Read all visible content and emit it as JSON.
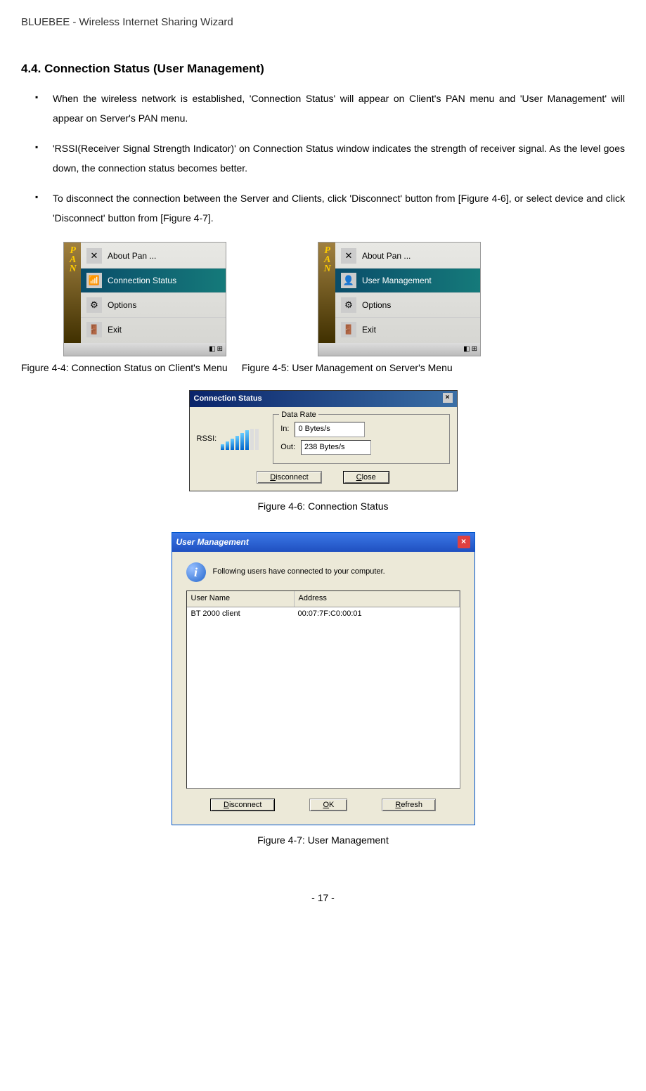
{
  "header": "BLUEBEE - Wireless Internet Sharing Wizard",
  "section_title": "4.4. Connection Status (User Management)",
  "bullets": [
    "When the wireless network is established, 'Connection Status' will appear on Client's PAN menu and 'User Management' will appear on Server's PAN menu.",
    "'RSSI(Receiver Signal Strength Indicator)' on Connection Status window indicates the strength of receiver signal. As the level goes down, the connection status becomes better.",
    "To disconnect the connection between the Server and Clients, click 'Disconnect' button from [Figure 4-6], or select device and click 'Disconnect' button from [Figure 4-7]."
  ],
  "client_menu": {
    "about": "About Pan ...",
    "conn_status": "Connection Status",
    "options": "Options",
    "exit": "Exit",
    "highlighted": "conn_status"
  },
  "server_menu": {
    "about": "About Pan ...",
    "user_mgmt": "User Management",
    "options": "Options",
    "exit": "Exit",
    "highlighted": "user_mgmt"
  },
  "caption_4_4": "Figure 4-4: Connection Status on Client's Menu",
  "caption_4_5": "Figure 4-5: User Management on Server's Menu",
  "conn_status_dlg": {
    "title": "Connection Status",
    "rssi_label": "RSSI:",
    "group_label": "Data Rate",
    "in_label": "In:",
    "in_value": "0 Bytes/s",
    "out_label": "Out:",
    "out_value": "238 Bytes/s",
    "disconnect": "Disconnect",
    "close": "Close"
  },
  "caption_4_6": "Figure 4-6: Connection Status",
  "user_mgmt_dlg": {
    "title": "User Management",
    "info_text": "Following users have connected to your computer.",
    "col_username": "User Name",
    "col_address": "Address",
    "row_name": "BT 2000 client",
    "row_addr": "00:07:7F:C0:00:01",
    "disconnect": "Disconnect",
    "ok": "OK",
    "refresh": "Refresh"
  },
  "caption_4_7": "Figure 4-7: User Management",
  "page_number": "- 17 -",
  "pan_label": "PAN"
}
